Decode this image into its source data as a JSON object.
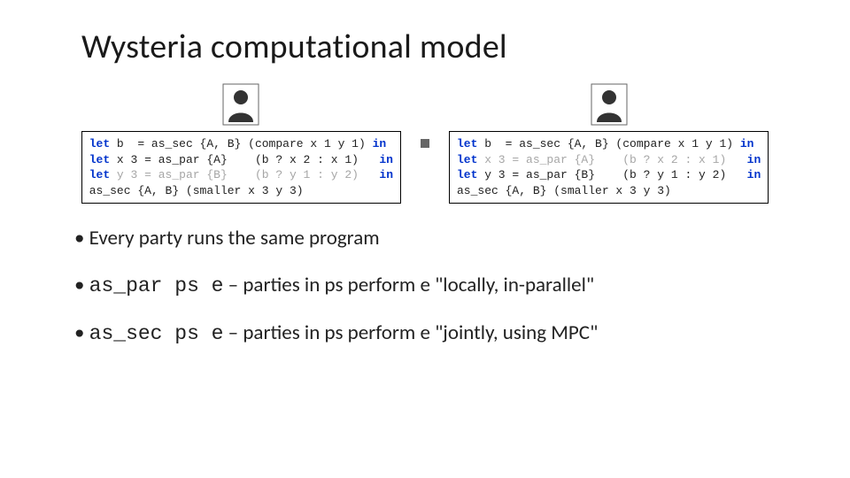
{
  "title": "Wysteria computational model",
  "code": {
    "left": {
      "line1_pre": "let",
      "line1_mid": " b  = as_sec {A, B} (compare x 1 y 1) ",
      "line1_post": "in",
      "line2_pre": "let",
      "line2_mid": " x 3 = as_par {A}    (b ? x 2 : x 1)   ",
      "line2_post": "in",
      "line3_pre": "let",
      "line3_grayA": " y 3 = as_par ",
      "line3_grayB": "{B}    (b ? y 1 : y 2)   ",
      "line3_post": "in",
      "line4": "as_sec {A, B} (smaller x 3 y 3)"
    },
    "right": {
      "line1_pre": "let",
      "line1_mid": " b  = as_sec {A, B} (compare x 1 y 1) ",
      "line1_post": "in",
      "line2_pre": "let",
      "line2_grayA": " x 3 = as_par ",
      "line2_grayB": "{A}    (b ? x 2 : x 1)   ",
      "line2_post": "in",
      "line3_pre": "let",
      "line3_mid": " y 3 = as_par {B}    (b ? y 1 : y 2)   ",
      "line3_post": "in",
      "line4": "as_sec {A, B} (smaller x 3 y 3)"
    }
  },
  "bullets": {
    "b1": "Every party runs the same program",
    "b2_code": "as_par ps e",
    "b2_sep": " – ",
    "b2_text": "parties in ps perform e \"locally, in-parallel\"",
    "b3_code": "as_sec ps e",
    "b3_sep": " – ",
    "b3_text": "parties in ps perform e \"jointly, using MPC\""
  }
}
